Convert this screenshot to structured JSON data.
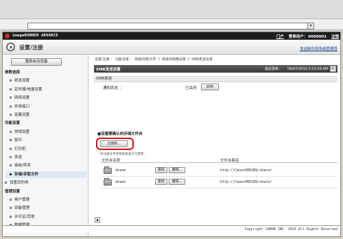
{
  "browser": {
    "address_value": "",
    "dropdown_icon": "chevron-down-icon"
  },
  "brand": {
    "name": "imageRUNNER ADVANCE"
  },
  "user_bar": {
    "portal": "门户",
    "login_user_label": "登录用户：",
    "user_id": "0000001",
    "logout": "注销"
  },
  "header": {
    "title": "设置/注册",
    "mail_link": "发送邮件到系统管理员"
  },
  "sidebar": {
    "restart_label": "重新启动设备",
    "items": [
      {
        "label": "参数选择",
        "kind": "group"
      },
      {
        "label": "纸张设置",
        "kind": "item"
      },
      {
        "label": "定时器/电量设置",
        "kind": "item"
      },
      {
        "label": "网络设置",
        "kind": "item"
      },
      {
        "label": "外部接口",
        "kind": "item"
      },
      {
        "label": "音量设置",
        "kind": "item"
      },
      {
        "label": "功能设置",
        "kind": "group"
      },
      {
        "label": "常规设置",
        "kind": "item"
      },
      {
        "label": "复印",
        "kind": "item"
      },
      {
        "label": "打印机",
        "kind": "item"
      },
      {
        "label": "发送",
        "kind": "item"
      },
      {
        "label": "接收/转发",
        "kind": "item"
      },
      {
        "label": "存储/存取文件",
        "kind": "active"
      },
      {
        "label": "设置目的地",
        "kind": "sub"
      },
      {
        "label": "管理设置",
        "kind": "group"
      },
      {
        "label": "用户管理",
        "kind": "item"
      },
      {
        "label": "设备管理",
        "kind": "item"
      },
      {
        "label": "许可证/其他",
        "kind": "item"
      },
      {
        "label": "数据管理",
        "kind": "item"
      }
    ]
  },
  "breadcrumb": "设置/注册 ： 功能设置 ： 存储/存取文件 ＞ 高级存储箱设置 ＞ SMB发送设置",
  "panel": {
    "title": "SMB发送设置",
    "last_updated_label": "最后更新：",
    "last_updated_value": "09/07/2010 3:23:39 AM",
    "refresh_icon": "refresh-icon"
  },
  "smb_section": {
    "title": "SMB发送",
    "status_label": "通知状态 ：",
    "status_value": "已关闭",
    "enable_button": "启用"
  },
  "folder_section": {
    "title": "■设置要确认的存储文件夹",
    "register_button": "注册新...",
    "note": "*未注册文件夹将被接收方已使用。",
    "col_name": "文件夹名称",
    "col_path": "文件夹路径",
    "rows": [
      {
        "name": "share",
        "delete": "删除",
        "edit": "编辑...",
        "path": "http://Canon36E289/share/"
      },
      {
        "name": "share",
        "delete": "删除",
        "edit": "编辑...",
        "path": "http://Canon36E289/share/"
      }
    ]
  },
  "back_to_top_icon": "arrow-up-icon",
  "footer": {
    "copyright": "Copyright CANON INC. 2010 All Rights Reserved"
  },
  "colors": {
    "highlight": "#d10f12",
    "titlebar": "#3a3a3a",
    "brandbar": "#1d1d1d"
  }
}
